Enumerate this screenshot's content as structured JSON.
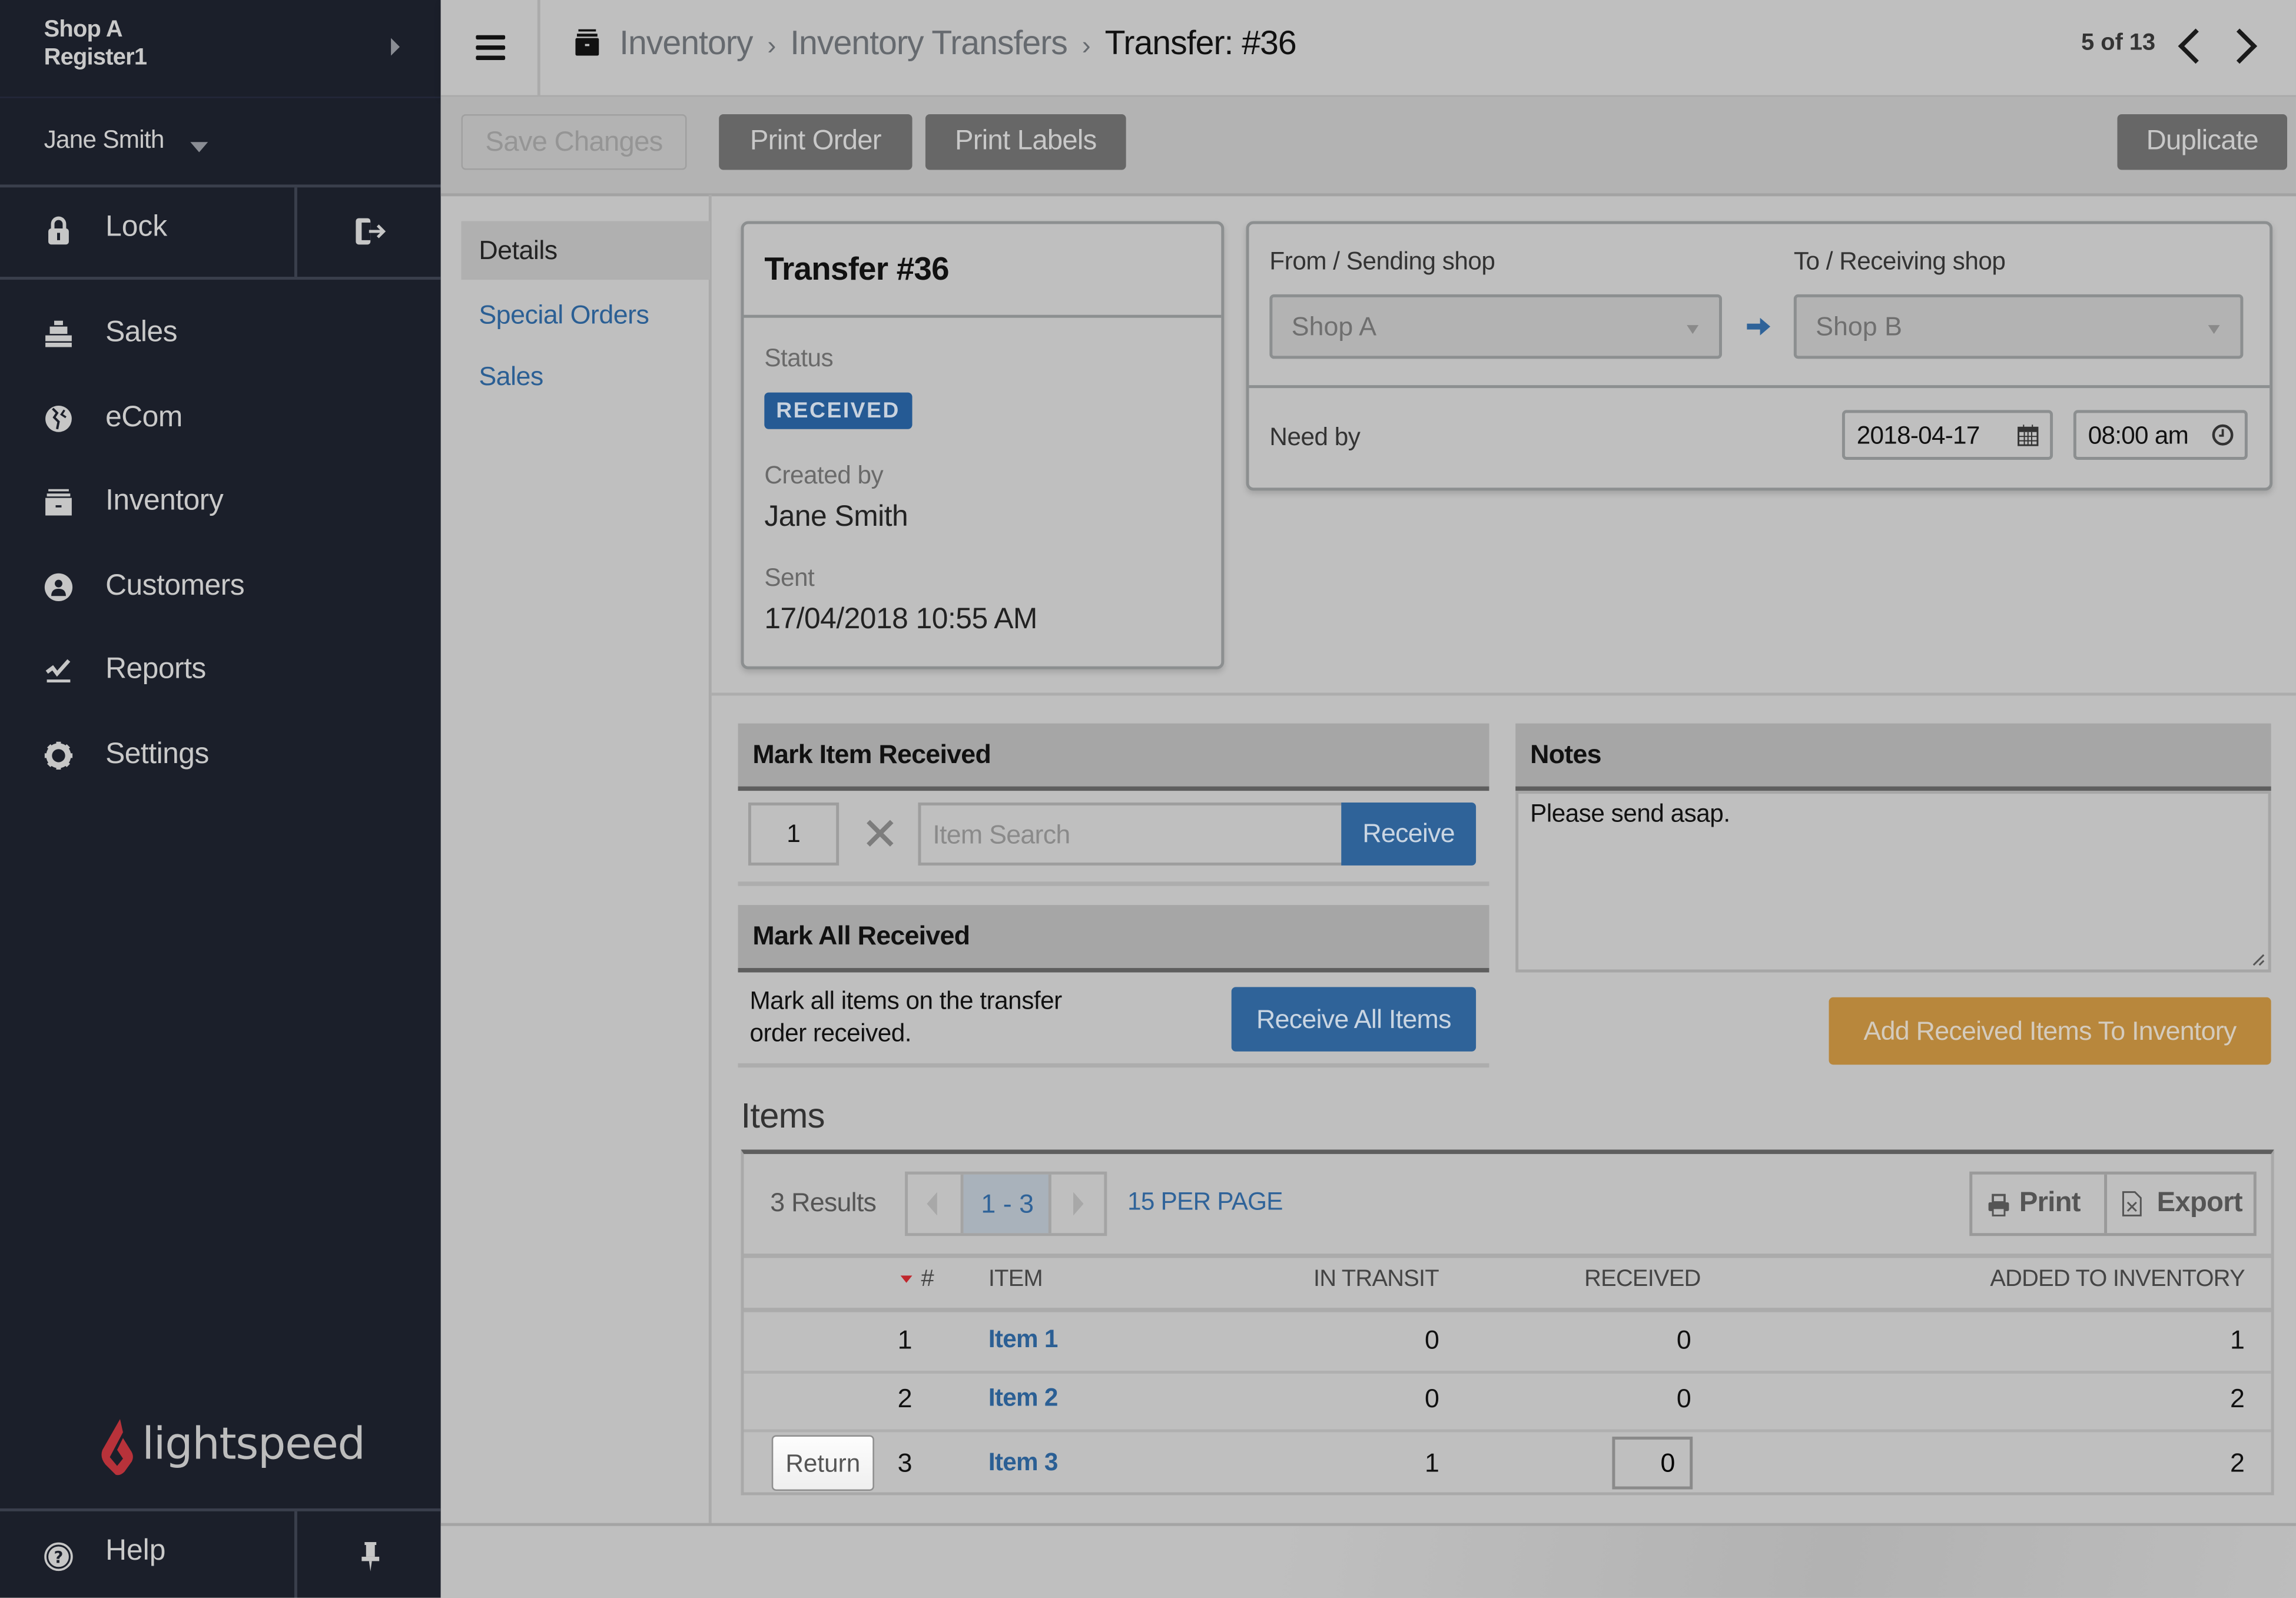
{
  "sidebar": {
    "shop_name": "Shop A",
    "register_name": "Register1",
    "user_name": "Jane Smith",
    "lock_label": "Lock",
    "nav": [
      {
        "label": "Sales",
        "icon": "cash-register-icon"
      },
      {
        "label": "eCom",
        "icon": "globe-icon"
      },
      {
        "label": "Inventory",
        "icon": "archive-box-icon"
      },
      {
        "label": "Customers",
        "icon": "user-circle-icon"
      },
      {
        "label": "Reports",
        "icon": "chart-line-icon"
      },
      {
        "label": "Settings",
        "icon": "gear-icon"
      }
    ],
    "logo_text": "lightspeed",
    "help_label": "Help"
  },
  "header": {
    "breadcrumb": [
      "Inventory",
      "Inventory Transfers"
    ],
    "current": "Transfer: #36",
    "record_position": "5 of 13"
  },
  "toolbar": {
    "save_label": "Save Changes",
    "print_order_label": "Print Order",
    "print_labels_label": "Print Labels",
    "duplicate_label": "Duplicate"
  },
  "subnav": {
    "items": [
      "Details",
      "Special Orders",
      "Sales"
    ],
    "active": "Details"
  },
  "transfer": {
    "title": "Transfer #36",
    "status_label": "Status",
    "status": "RECEIVED",
    "status_color": "#255a94",
    "created_by_label": "Created by",
    "created_by": "Jane Smith",
    "sent_label": "Sent",
    "sent": "17/04/2018 10:55 AM"
  },
  "shops": {
    "from_label": "From / Sending shop",
    "from_value": "Shop A",
    "to_label": "To / Receiving shop",
    "to_value": "Shop B",
    "need_by_label": "Need by",
    "need_by_date": "2018-04-17",
    "need_by_time": "08:00 am"
  },
  "mark_item": {
    "title": "Mark Item Received",
    "quantity": "1",
    "search_placeholder": "Item Search",
    "receive_label": "Receive"
  },
  "mark_all": {
    "title": "Mark All Received",
    "description": "Mark all items on the transfer order received.",
    "button_label": "Receive All Items"
  },
  "notes": {
    "title": "Notes",
    "value": "Please send asap.",
    "add_button_label": "Add Received Items To Inventory",
    "add_button_color": "#b8873c"
  },
  "items": {
    "title": "Items",
    "results": "3 Results",
    "page_range": "1 - 3",
    "per_page": "15 PER PAGE",
    "print_label": "Print",
    "export_label": "Export",
    "columns": [
      "#",
      "ITEM",
      "IN TRANSIT",
      "RECEIVED",
      "ADDED TO INVENTORY"
    ],
    "rows": [
      {
        "num": "1",
        "item": "Item 1",
        "in_transit": "0",
        "received": "0",
        "added": "1",
        "return_button": null
      },
      {
        "num": "2",
        "item": "Item 2",
        "in_transit": "0",
        "received": "0",
        "added": "2",
        "return_button": null
      },
      {
        "num": "3",
        "item": "Item 3",
        "in_transit": "1",
        "received": "0",
        "added": "2",
        "return_button": "Return"
      }
    ]
  }
}
